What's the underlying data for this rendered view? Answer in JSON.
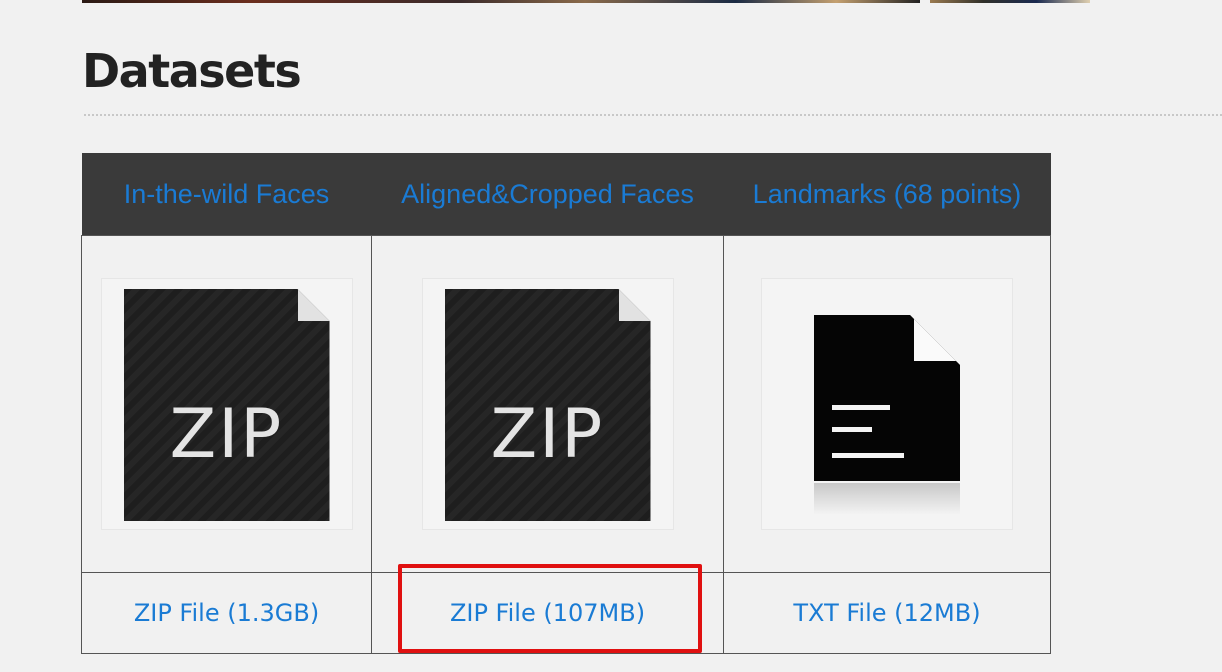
{
  "page": {
    "title": "Datasets"
  },
  "table": {
    "columns": [
      {
        "header": "In-the-wild Faces",
        "icon": "zip-file-icon",
        "icon_text": "ZIP",
        "link": "ZIP File (1.3GB)"
      },
      {
        "header": "Aligned&Cropped Faces",
        "icon": "zip-file-icon",
        "icon_text": "ZIP",
        "link": "ZIP File (107MB)"
      },
      {
        "header": "Landmarks (68 points)",
        "icon": "txt-file-icon",
        "link": "TXT File (12MB)"
      }
    ]
  },
  "colors": {
    "link": "#1a7bd4",
    "header_bg": "#3a3a3a",
    "highlight": "#e01010"
  }
}
